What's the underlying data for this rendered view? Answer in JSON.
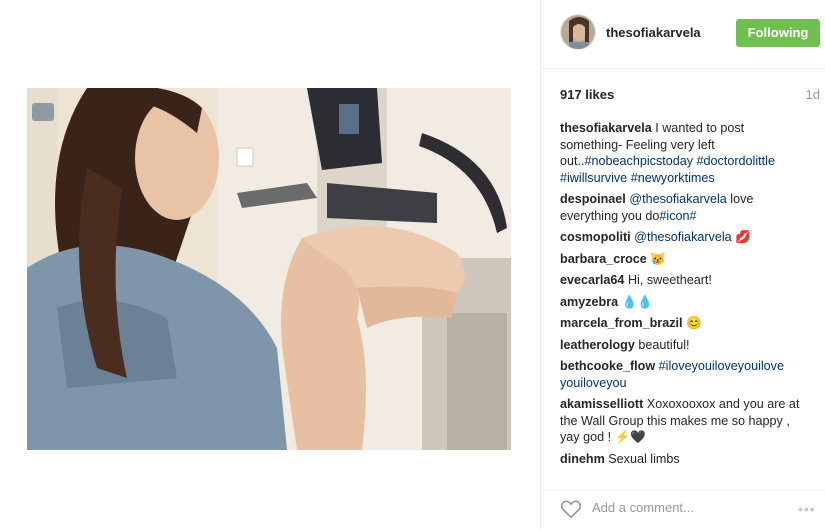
{
  "post": {
    "username": "thesofiakarvela",
    "follow_label": "Following",
    "likes": "917 likes",
    "age": "1d"
  },
  "caption": {
    "user": "thesofiakarvela",
    "text_plain": "I wanted to post something- Feeling very left out..",
    "tags": [
      "#nobeachpicstoday",
      "#doctordolittle",
      "#iwillsurvive",
      "#newyorktimes"
    ]
  },
  "comments": [
    {
      "user": "despoinael",
      "mention": "@thesofiakarvela",
      "text": " love everything you do",
      "tag": "#icon#"
    },
    {
      "user": "cosmopoliti",
      "mention": "@thesofiakarvela",
      "text": " 💋"
    },
    {
      "user": "barbara_croce",
      "text": "😿"
    },
    {
      "user": "evecarla64",
      "text": "Hi, sweetheart!"
    },
    {
      "user": "amyzebra",
      "text": "💧💧"
    },
    {
      "user": "marcela_from_brazil",
      "text": "😊"
    },
    {
      "user": "leatherology",
      "text": "beautiful!"
    },
    {
      "user": "bethcooke_flow",
      "tag": "#iloveyouiloveyouilove youiloveyou"
    },
    {
      "user": "akamisselliott",
      "text": "Xoxoxooxox and you are at the Wall Group this makes me so happy , yay god ! ⚡🖤"
    },
    {
      "user": "dinehm",
      "text": "Sexual limbs"
    }
  ],
  "footer": {
    "add_comment_placeholder": "Add a comment...",
    "more_label": "•••"
  },
  "colors": {
    "follow_bg": "#70c050",
    "link": "#003569",
    "muted": "#999999"
  },
  "icons": [
    "heart-icon",
    "more-options-icon"
  ]
}
